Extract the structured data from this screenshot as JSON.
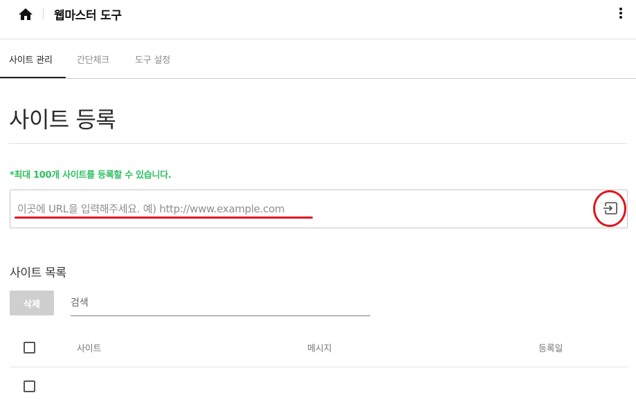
{
  "header": {
    "title": "웹마스터 도구",
    "home_icon": "home-icon",
    "more_icon": "more-vertical-icon"
  },
  "tabs": [
    {
      "label": "사이트 관리",
      "active": true
    },
    {
      "label": "간단체크",
      "active": false
    },
    {
      "label": "도구 설정",
      "active": false
    }
  ],
  "page_title": "사이트 등록",
  "notice": "*최대 100개 사이트를 등록할 수 있습니다.",
  "url_input": {
    "value": "",
    "placeholder": "이곳에 URL을 입력해주세요. 예) http://www.example.com",
    "submit_icon": "enter-icon"
  },
  "site_list": {
    "title": "사이트 목록",
    "delete_label": "삭제",
    "search_placeholder": "검색",
    "columns": [
      "사이트",
      "메시지",
      "등록일"
    ],
    "rows": [
      {
        "checked": false
      }
    ]
  },
  "colors": {
    "accent_green": "#2fbf5f",
    "annotation_red": "#e0141e",
    "disabled_button": "#cfcfcf"
  }
}
